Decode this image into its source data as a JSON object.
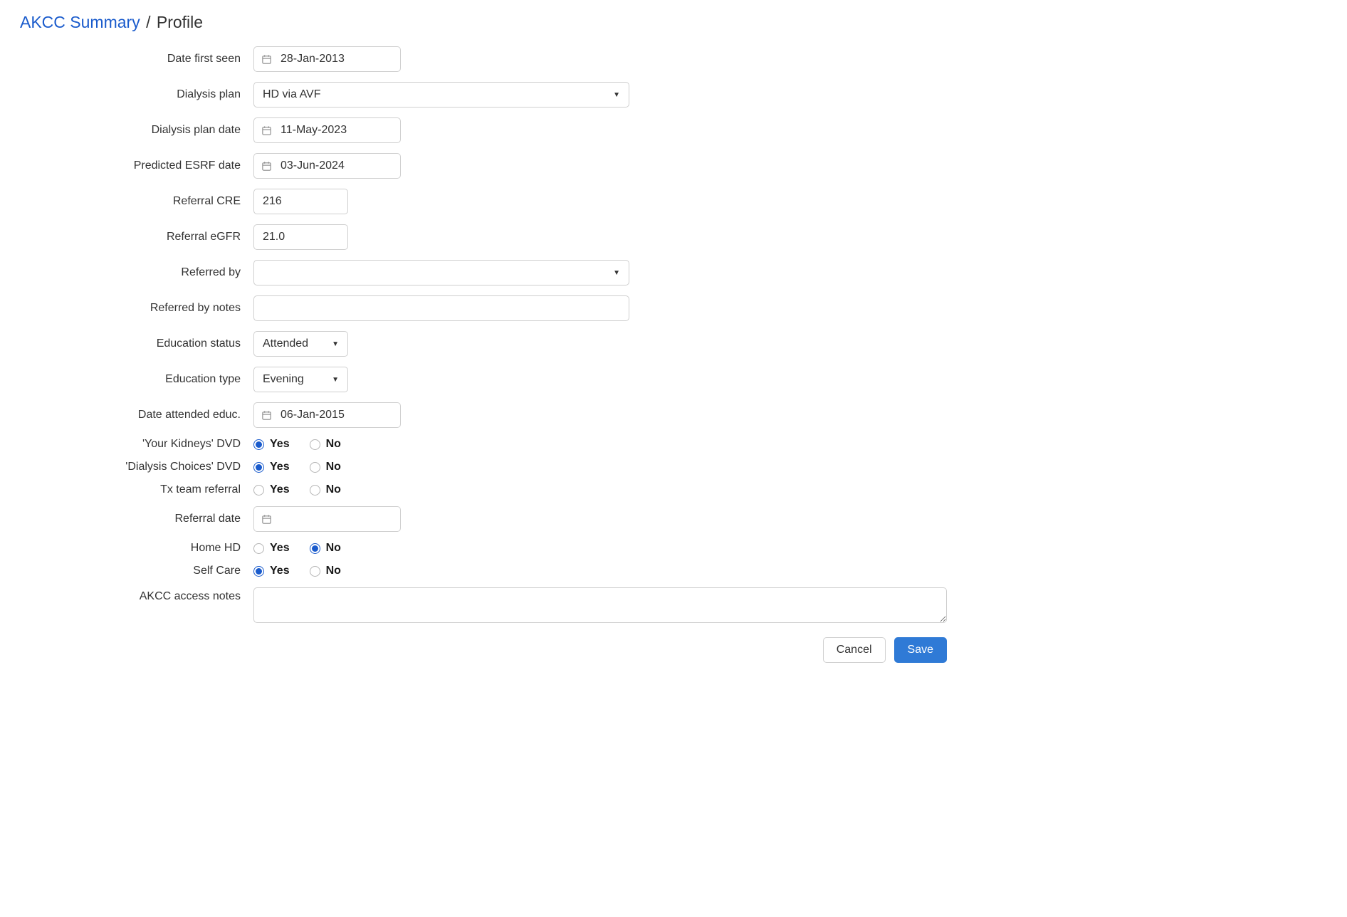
{
  "breadcrumb": {
    "link": "AKCC Summary",
    "sep": "/",
    "current": "Profile"
  },
  "labels": {
    "date_first_seen": "Date first seen",
    "dialysis_plan": "Dialysis plan",
    "dialysis_plan_date": "Dialysis plan date",
    "predicted_esrf_date": "Predicted ESRF date",
    "referral_cre": "Referral CRE",
    "referral_egfr": "Referral eGFR",
    "referred_by": "Referred by",
    "referred_by_notes": "Referred by notes",
    "education_status": "Education status",
    "education_type": "Education type",
    "date_attended_educ": "Date attended educ.",
    "your_kidneys_dvd": "'Your Kidneys' DVD",
    "dialysis_choices_dvd": "'Dialysis Choices' DVD",
    "tx_team_referral": "Tx team referral",
    "referral_date": "Referral date",
    "home_hd": "Home HD",
    "self_care": "Self Care",
    "akcc_access_notes": "AKCC access notes"
  },
  "values": {
    "date_first_seen": "28-Jan-2013",
    "dialysis_plan": "HD via AVF",
    "dialysis_plan_date": "11-May-2023",
    "predicted_esrf_date": "03-Jun-2024",
    "referral_cre": "216",
    "referral_egfr": "21.0",
    "referred_by": "",
    "referred_by_notes": "",
    "education_status": "Attended",
    "education_type": "Evening",
    "date_attended_educ": "06-Jan-2015",
    "referral_date": "",
    "akcc_access_notes": ""
  },
  "radio": {
    "yes": "Yes",
    "no": "No",
    "your_kidneys_dvd": "yes",
    "dialysis_choices_dvd": "yes",
    "tx_team_referral": "",
    "home_hd": "no",
    "self_care": "yes"
  },
  "buttons": {
    "cancel": "Cancel",
    "save": "Save"
  }
}
